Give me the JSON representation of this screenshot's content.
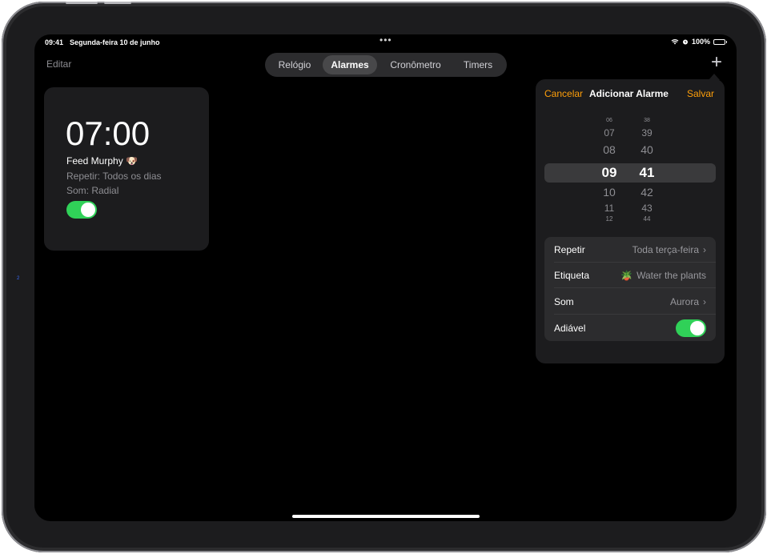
{
  "status_bar": {
    "time": "09:41",
    "date": "Segunda-feira 10 de junho",
    "dots": "•••",
    "battery": "100%"
  },
  "header": {
    "edit": "Editar",
    "tabs": [
      {
        "label": "Relógio"
      },
      {
        "label": "Alarmes"
      },
      {
        "label": "Cronômetro"
      },
      {
        "label": "Timers"
      }
    ],
    "active_tab": "Alarmes",
    "add_glyph": "+"
  },
  "alarm": {
    "time": "07:00",
    "label": "Feed Murphy 🐶",
    "repeat": "Repetir: Todos os dias",
    "sound": "Som: Radial",
    "enabled": true
  },
  "add_alarm": {
    "cancel": "Cancelar",
    "title": "Adicionar Alarme",
    "save": "Salvar",
    "hours": [
      "06",
      "07",
      "08",
      "09",
      "10",
      "11",
      "12"
    ],
    "minutes": [
      "38",
      "39",
      "40",
      "41",
      "42",
      "43",
      "44"
    ],
    "selected_hour": "09",
    "selected_minute": "41",
    "rows": {
      "repeat_label": "Repetir",
      "repeat_value": "Toda terça-feira",
      "label_label": "Etiqueta",
      "label_emoji": "🪴",
      "label_value": "Water the plants",
      "sound_label": "Som",
      "sound_value": "Aurora",
      "snooze_label": "Adiável",
      "snooze_on": true
    }
  },
  "colors": {
    "accent": "#ff9f0a",
    "toggle_on": "#30d158",
    "background": "#000000",
    "card": "#1c1c1e"
  },
  "side_mark": "2"
}
